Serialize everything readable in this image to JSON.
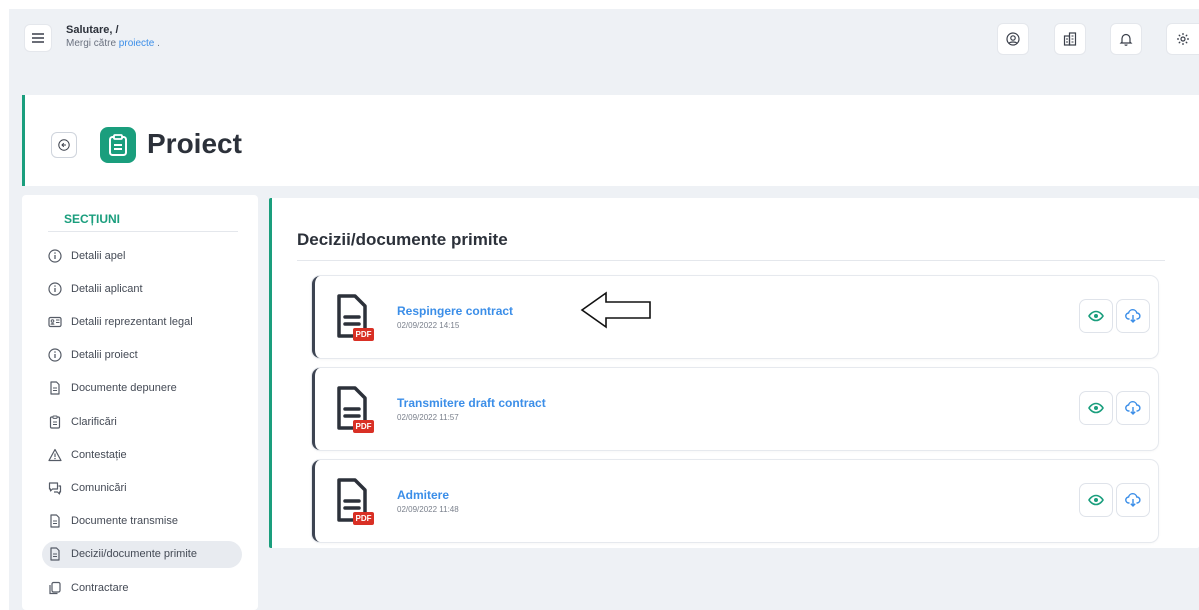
{
  "header": {
    "greeting": "Salutare, /",
    "subtitle_prefix": "Mergi către",
    "subtitle_link": "proiecte",
    "subtitle_suffix": ".",
    "icons": [
      "user-circle-icon",
      "building-icon",
      "bell-icon",
      "gear-icon"
    ]
  },
  "project": {
    "title": "Proiect"
  },
  "sidebar": {
    "title": "SECȚIUNI",
    "items": [
      {
        "label": "Detalii apel",
        "icon": "info-icon"
      },
      {
        "label": "Detalii aplicant",
        "icon": "info-icon"
      },
      {
        "label": "Detalii reprezentant legal",
        "icon": "id-card-icon"
      },
      {
        "label": "Detalii proiect",
        "icon": "info-icon"
      },
      {
        "label": "Documente depunere",
        "icon": "document-icon"
      },
      {
        "label": "Clarificări",
        "icon": "clipboard-icon"
      },
      {
        "label": "Contestație",
        "icon": "warning-icon"
      },
      {
        "label": "Comunicări",
        "icon": "chat-icon"
      },
      {
        "label": "Documente transmise",
        "icon": "document-icon"
      },
      {
        "label": "Decizii/documente primite",
        "icon": "document-icon",
        "active": true
      },
      {
        "label": "Contractare",
        "icon": "copy-icon"
      }
    ]
  },
  "main": {
    "title": "Decizii/documente primite",
    "documents": [
      {
        "name": "Respingere contract",
        "date": "02/09/2022 14:15",
        "badge": "PDF"
      },
      {
        "name": "Transmitere draft contract",
        "date": "02/09/2022 11:57",
        "badge": "PDF"
      },
      {
        "name": "Admitere",
        "date": "02/09/2022 11:48",
        "badge": "PDF"
      }
    ]
  },
  "colors": {
    "accent": "#1a9e7d",
    "link": "#3b8ee8",
    "pdf_badge": "#d93025"
  }
}
